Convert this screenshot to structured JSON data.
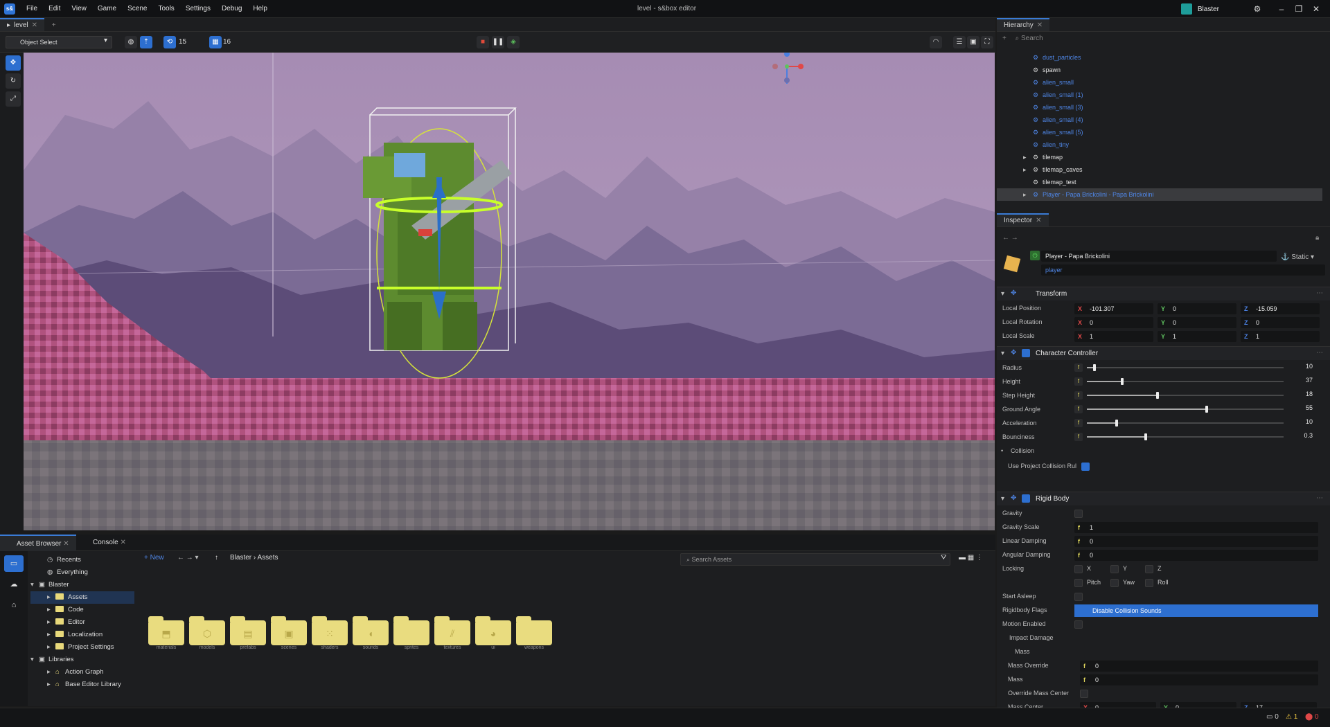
{
  "app": {
    "logo": "s&",
    "title": "level - s&box editor",
    "user": "Blaster"
  },
  "menu": [
    "File",
    "Edit",
    "View",
    "Game",
    "Scene",
    "Tools",
    "Settings",
    "Debug",
    "Help"
  ],
  "scene_tab": {
    "label": "level"
  },
  "toolbar": {
    "mode": "Object Select",
    "snap_value": "15",
    "grid_value": "16"
  },
  "hierarchy": {
    "tab": "Hierarchy",
    "search_placeholder": "Search",
    "items": [
      {
        "label": "dust_particles",
        "indent": 3,
        "blue": true,
        "expand": false
      },
      {
        "label": "spawn",
        "indent": 3,
        "blue": false,
        "expand": false
      },
      {
        "label": "alien_small",
        "indent": 3,
        "blue": true,
        "expand": false
      },
      {
        "label": "alien_small (1)",
        "indent": 3,
        "blue": true,
        "expand": false
      },
      {
        "label": "alien_small (3)",
        "indent": 3,
        "blue": true,
        "expand": false
      },
      {
        "label": "alien_small (4)",
        "indent": 3,
        "blue": true,
        "expand": false
      },
      {
        "label": "alien_small (5)",
        "indent": 3,
        "blue": true,
        "expand": false
      },
      {
        "label": "alien_tiny",
        "indent": 3,
        "blue": true,
        "expand": false
      },
      {
        "label": "tilemap",
        "indent": 3,
        "blue": false,
        "expand": true
      },
      {
        "label": "tilemap_caves",
        "indent": 3,
        "blue": false,
        "expand": true
      },
      {
        "label": "tilemap_test",
        "indent": 3,
        "blue": false,
        "expand": false
      },
      {
        "label": "Player - Papa Brickolini - Papa Brickolini",
        "indent": 3,
        "blue": true,
        "expand": true,
        "selected": true
      }
    ]
  },
  "inspector": {
    "tab": "Inspector",
    "object_name": "Player - Papa Brickolini",
    "static_label": "Static",
    "tag": "player",
    "transform": {
      "title": "Transform",
      "rows": [
        {
          "label": "Local Position",
          "x": "-101.307",
          "y": "0",
          "z": "-15.059"
        },
        {
          "label": "Local Rotation",
          "x": "0",
          "y": "0",
          "z": "0"
        },
        {
          "label": "Local Scale",
          "x": "1",
          "y": "1",
          "z": "1"
        }
      ]
    },
    "character_controller": {
      "title": "Character Controller",
      "sliders": [
        {
          "label": "Radius",
          "value": "10",
          "frac": 0.04
        },
        {
          "label": "Height",
          "value": "37",
          "frac": 0.18
        },
        {
          "label": "Step Height",
          "value": "18",
          "frac": 0.36
        },
        {
          "label": "Ground Angle",
          "value": "55",
          "frac": 0.61
        },
        {
          "label": "Acceleration",
          "value": "10",
          "frac": 0.15
        },
        {
          "label": "Bounciness",
          "value": "0.3",
          "frac": 0.3
        }
      ],
      "collision_label": "Collision",
      "use_project_collision": "Use Project Collision Rul"
    },
    "rigid_body": {
      "title": "Rigid Body",
      "gravity": "Gravity",
      "gravity_scale_label": "Gravity Scale",
      "gravity_scale": "1",
      "linear_damping_label": "Linear Damping",
      "linear_damping": "0",
      "angular_damping_label": "Angular Damping",
      "angular_damping": "0",
      "locking_label": "Locking",
      "lock_x": "X",
      "lock_y": "Y",
      "lock_z": "Z",
      "pitch": "Pitch",
      "yaw": "Yaw",
      "roll": "Roll",
      "start_asleep": "Start Asleep",
      "flags_label": "Rigidbody Flags",
      "flags_value": "Disable Collision Sounds",
      "motion_enabled": "Motion Enabled",
      "impact_damage": "Impact Damage",
      "mass_section": "Mass",
      "mass_override_label": "Mass Override",
      "mass_override": "0",
      "mass_label": "Mass",
      "mass": "0",
      "override_center": "Override Mass Center",
      "mass_center_label": "Mass Center",
      "mass_center": {
        "x": "0",
        "y": "0",
        "z": "17"
      }
    }
  },
  "bottom": {
    "tabs": [
      "Asset Browser",
      "Console"
    ],
    "tree": [
      {
        "label": "Recents",
        "indent": 1,
        "icon": "clock"
      },
      {
        "label": "Everything",
        "indent": 1,
        "icon": "globe"
      },
      {
        "label": "Blaster",
        "indent": 0,
        "icon": "box",
        "expand": true
      },
      {
        "label": "Assets",
        "indent": 2,
        "icon": "folder",
        "selected": true
      },
      {
        "label": "Code",
        "indent": 2,
        "icon": "folder"
      },
      {
        "label": "Editor",
        "indent": 2,
        "icon": "folder"
      },
      {
        "label": "Localization",
        "indent": 2,
        "icon": "folder"
      },
      {
        "label": "Project Settings",
        "indent": 2,
        "icon": "folder"
      },
      {
        "label": "Libraries",
        "indent": 0,
        "icon": "box",
        "expand": true
      },
      {
        "label": "Action Graph",
        "indent": 2,
        "icon": "lib"
      },
      {
        "label": "Base Editor Library",
        "indent": 2,
        "icon": "lib"
      }
    ],
    "new_label": "New",
    "breadcrumb": [
      "Blaster",
      "Assets"
    ],
    "search_placeholder": "Search Assets",
    "folders": [
      {
        "name": "materials",
        "glyph": "⬒"
      },
      {
        "name": "models",
        "glyph": "⬡"
      },
      {
        "name": "prefabs",
        "glyph": "▤"
      },
      {
        "name": "scenes",
        "glyph": "▣"
      },
      {
        "name": "shaders",
        "glyph": "⁙"
      },
      {
        "name": "sounds",
        "glyph": "◖"
      },
      {
        "name": "sprites",
        "glyph": ""
      },
      {
        "name": "textures",
        "glyph": "⫽"
      },
      {
        "name": "ui",
        "glyph": "◕"
      },
      {
        "name": "weapons",
        "glyph": ""
      }
    ]
  },
  "status": {
    "errors": "0",
    "warnings": "1",
    "info": "0"
  }
}
